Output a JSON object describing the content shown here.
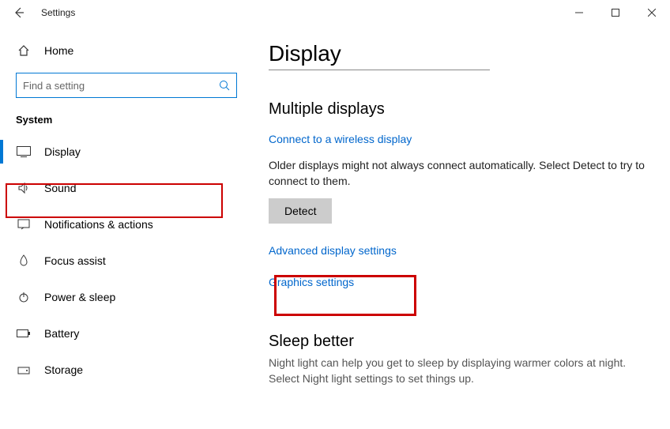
{
  "titlebar": {
    "title": "Settings"
  },
  "sidebar": {
    "home_label": "Home",
    "search_placeholder": "Find a setting",
    "section_label": "System",
    "items": [
      {
        "label": "Display",
        "icon": "display-icon",
        "selected": true
      },
      {
        "label": "Sound",
        "icon": "sound-icon"
      },
      {
        "label": "Notifications & actions",
        "icon": "notifications-icon"
      },
      {
        "label": "Focus assist",
        "icon": "focus-assist-icon"
      },
      {
        "label": "Power & sleep",
        "icon": "power-icon"
      },
      {
        "label": "Battery",
        "icon": "battery-icon"
      },
      {
        "label": "Storage",
        "icon": "storage-icon"
      }
    ]
  },
  "main": {
    "page_title": "Display",
    "section1_heading": "Multiple displays",
    "wireless_link": "Connect to a wireless display",
    "detect_text": "Older displays might not always connect automatically. Select Detect to try to connect to them.",
    "detect_button": "Detect",
    "advanced_link": "Advanced display settings",
    "graphics_link": "Graphics settings",
    "section2_heading": "Sleep better",
    "sleep_text": "Night light can help you get to sleep by displaying warmer colors at night. Select Night light settings to set things up."
  }
}
